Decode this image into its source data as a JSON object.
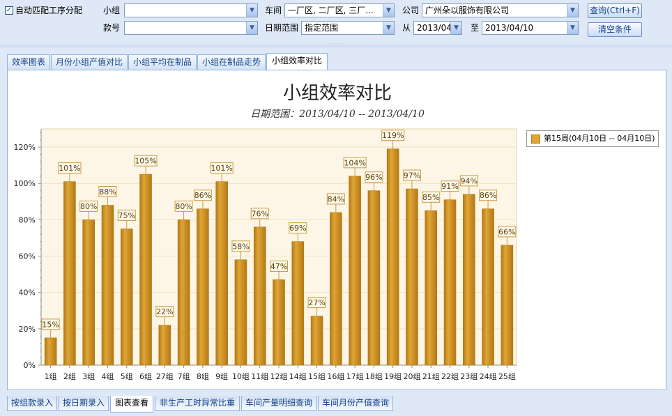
{
  "filters": {
    "auto_match_label": "自动匹配工序分配",
    "group_label": "小组",
    "group_value": "",
    "workshop_label": "车间",
    "workshop_value": "一厂区, 二厂区, 三厂...",
    "company_label": "公司",
    "company_value": "广州朵以服饰有限公司",
    "style_label": "款号",
    "style_value": "",
    "date_range_label": "日期范围",
    "date_range_value": "指定范围",
    "from_label": "从",
    "from_value": "2013/04",
    "to_label": "至",
    "to_value": "2013/04/10",
    "query_button": "查询(Ctrl+F)",
    "clear_button": "清空条件"
  },
  "top_tabs": [
    "效率图表",
    "月份小组产值对比",
    "小组平均在制品",
    "小组在制品走势",
    "小组效率对比"
  ],
  "active_top_tab": 4,
  "bottom_tabs": [
    "按组款录入",
    "按日期录入",
    "图表查看",
    "非生产工时异常比重",
    "车间产量明细查询",
    "车间月份产值查询"
  ],
  "active_bottom_tab": 2,
  "chart_data": {
    "type": "bar",
    "title": "小组效率对比",
    "subtitle": "日期范围：2013/04/10 -- 2013/04/10",
    "categories": [
      "1组",
      "2组",
      "3组",
      "4组",
      "5组",
      "6组",
      "27组",
      "7组",
      "8组",
      "9组",
      "10组",
      "11组",
      "12组",
      "14组",
      "15组",
      "16组",
      "17组",
      "18组",
      "19组",
      "20组",
      "21组",
      "22组",
      "23组",
      "24组",
      "25组"
    ],
    "series": [
      {
        "name": "第15周(04月10日 -- 04月10日)",
        "values": [
          15,
          101,
          80,
          88,
          75,
          105,
          22,
          80,
          86,
          101,
          58,
          76,
          47,
          68,
          27,
          84,
          104,
          96,
          119,
          97,
          85,
          91,
          94,
          86,
          66
        ],
        "color": "#e0a535"
      }
    ],
    "data_labels": [
      "15%",
      "101%",
      "80%",
      "88%",
      "75%",
      "105%",
      "22%",
      "80%",
      "86%",
      "101%",
      "58%",
      "76%",
      "47%",
      "69%",
      "27%",
      "84%",
      "104%",
      "96%",
      "119%",
      "97%",
      "85%",
      "91%",
      "94%",
      "86%",
      "66%"
    ],
    "y_ticks": [
      "0%",
      "20%",
      "40%",
      "60%",
      "80%",
      "100%",
      "120%"
    ],
    "ylim": [
      0,
      130
    ],
    "legend_position": "top-right"
  },
  "colors": {
    "bar": "#e0a535",
    "bar_dark": "#b27916",
    "plot_bg": "#fdf6e6"
  }
}
